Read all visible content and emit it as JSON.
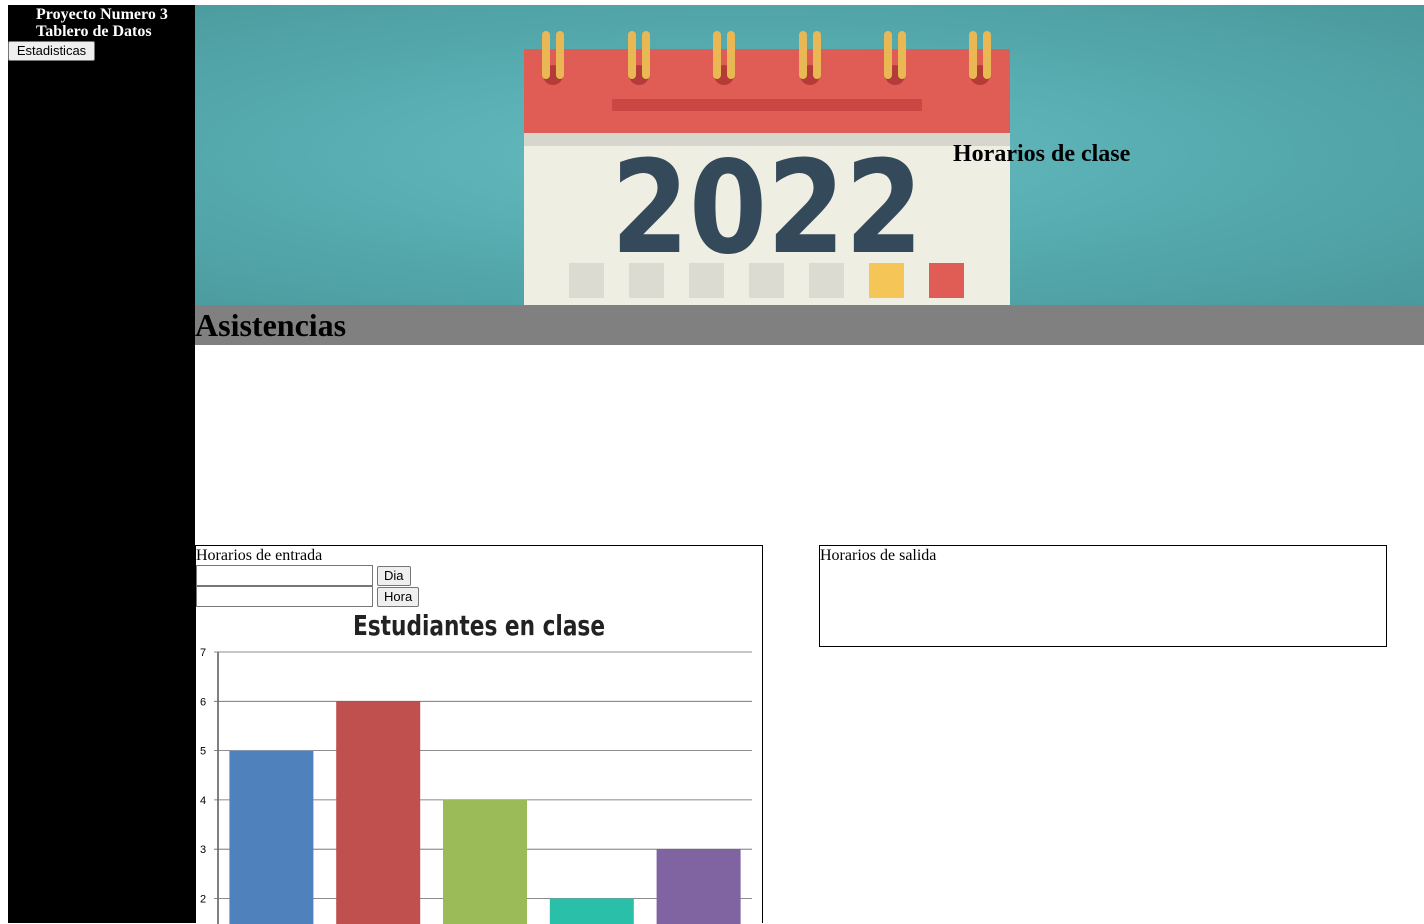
{
  "sidebar": {
    "title_line1": "Proyecto Numero 3",
    "title_line2": "Tablero de Datos",
    "stats_button": "Estadisticas"
  },
  "banner": {
    "year": "2022",
    "title": "Horarios de clase",
    "colors": {
      "calendar_top": "#e05d55",
      "calendar_body": "#efeee2",
      "year_text": "#34495a",
      "rings": "#e9b754"
    }
  },
  "section": {
    "heading": "Asistencias"
  },
  "entry_panel": {
    "label": "Horarios de entrada",
    "day_input": {
      "value": "",
      "placeholder": ""
    },
    "day_button": "Dia",
    "hour_input": {
      "value": "",
      "placeholder": ""
    },
    "hour_button": "Hora"
  },
  "exit_panel": {
    "label": "Horarios de salida"
  },
  "chart_data": {
    "type": "bar",
    "title": "Estudiantes en clase",
    "categories": [
      "",
      "",
      "",
      "",
      ""
    ],
    "values": [
      5,
      6,
      4,
      2,
      3
    ],
    "colors": [
      "#4f81bd",
      "#c0504d",
      "#9bbb59",
      "#2abfa9",
      "#8064a2"
    ],
    "ylim": [
      0,
      7
    ],
    "yticks": [
      2,
      3,
      4,
      5,
      6,
      7
    ],
    "grid": true,
    "xlabel": "",
    "ylabel": ""
  }
}
